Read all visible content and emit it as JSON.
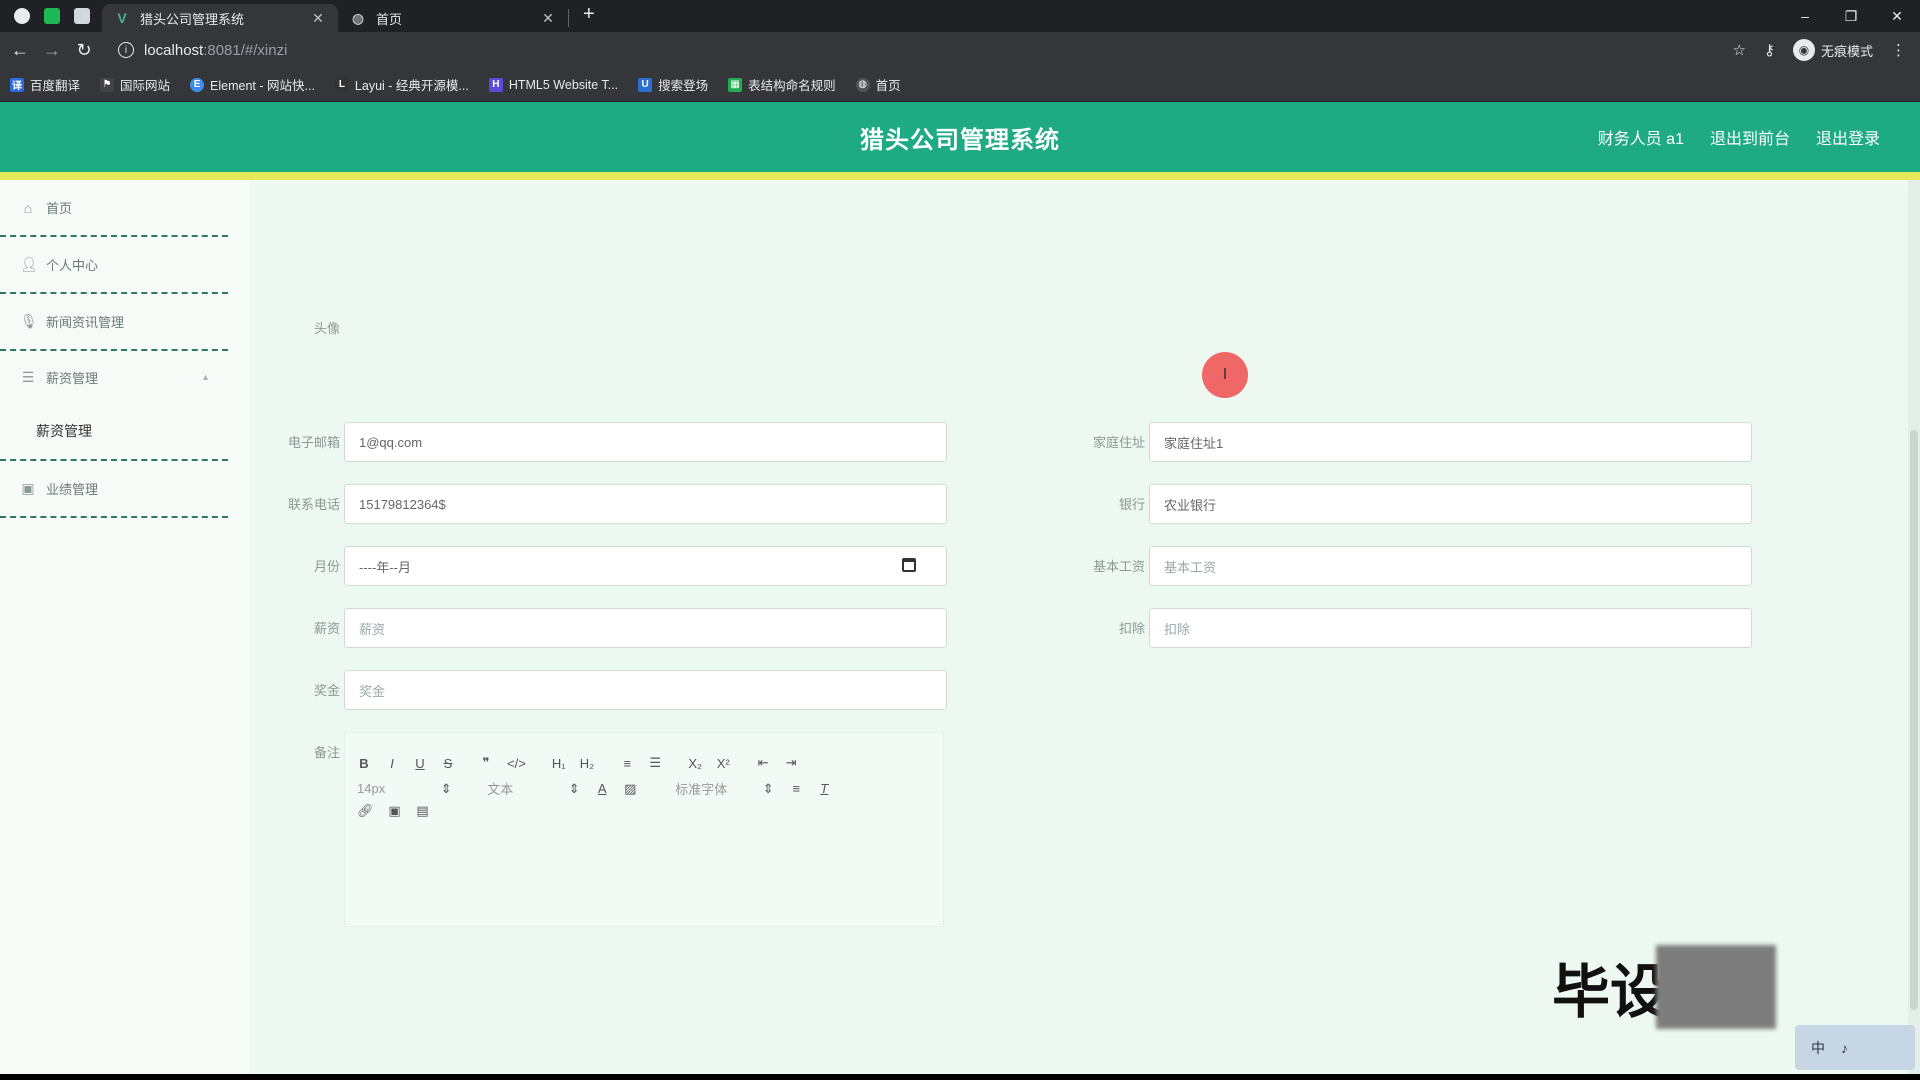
{
  "browser": {
    "tabs": [
      {
        "title": "猎头公司管理系统",
        "active": true
      },
      {
        "title": "首页",
        "active": false
      }
    ],
    "new_tab": "+",
    "window_controls": {
      "minimize": "–",
      "restore": "❐",
      "close": "✕"
    },
    "url_host": "localhost",
    "url_path": ":8081/#/xinzi",
    "incognito_label": "无痕模式",
    "bookmarks": [
      {
        "label": "百度翻译",
        "color": "#2b6de1"
      },
      {
        "label": "国际网站",
        "color": "#444444"
      },
      {
        "label": "Element - 网站快...",
        "color": "#3f8cf1"
      },
      {
        "label": "Layui - 经典开源模...",
        "color": "#333333"
      },
      {
        "label": "HTML5 Website T...",
        "color": "#5b4bd6"
      },
      {
        "label": "搜索登场",
        "color": "#2d6fd0"
      },
      {
        "label": "表结构命名规则",
        "color": "#22aa55"
      },
      {
        "label": "首页",
        "color": "#555555"
      }
    ]
  },
  "header": {
    "title": "猎头公司管理系统",
    "user": "财务人员 a1",
    "back_to_front": "退出到前台",
    "logout": "退出登录",
    "accent": "#1eaa83"
  },
  "sidebar": {
    "items": [
      {
        "label": "首页",
        "icon": "home-icon"
      },
      {
        "label": "个人中心",
        "icon": "user-icon"
      },
      {
        "label": "新闻资讯管理",
        "icon": "mic-icon"
      },
      {
        "label": "薪资管理",
        "icon": "list-icon"
      },
      {
        "label": "业绩管理",
        "icon": "clipboard-icon"
      }
    ],
    "submenu": "薪资管理"
  },
  "form": {
    "photo_label": "头像",
    "left": [
      {
        "label": "电子邮箱",
        "value": "1@qq.com"
      },
      {
        "label": "联系电话",
        "value": "15179812364$"
      },
      {
        "label": "月份",
        "value": "----年--月"
      },
      {
        "label": "薪资",
        "value": "薪资"
      },
      {
        "label": "奖金",
        "value": "奖金"
      }
    ],
    "right": [
      {
        "label": "家庭住址",
        "value": "家庭住址1"
      },
      {
        "label": "银行",
        "value": "农业银行"
      },
      {
        "label": "基本工资",
        "value": "基本工资"
      },
      {
        "label": "扣除",
        "value": "扣除"
      }
    ],
    "remarks_label": "备注",
    "editor": {
      "row1": [
        "B",
        "I",
        "U",
        "S",
        "❞",
        "</>",
        "H₁",
        "H₂",
        "≡",
        "☰",
        "X₂",
        "X²",
        "⇤",
        "⇥"
      ],
      "font_size": "14px",
      "text_style": "文本",
      "font_family": "标准字体"
    }
  },
  "cursor_glyph": "I",
  "watermark": "毕设",
  "ime": {
    "lang": "中",
    "extra": "♪"
  }
}
